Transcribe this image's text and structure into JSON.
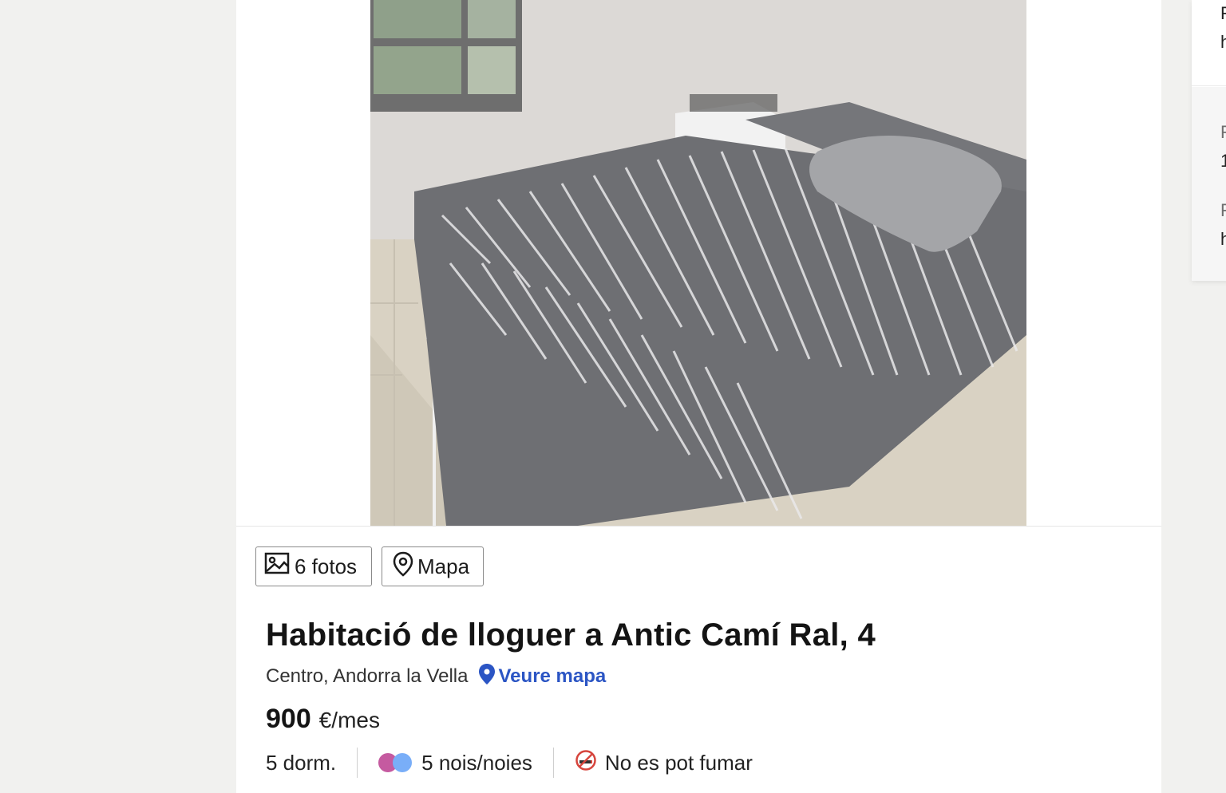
{
  "listing": {
    "photos_button": "6 fotos",
    "map_button": "Mapa",
    "title": "Habitació de lloguer a Antic Camí Ral, 4",
    "location": "Centro, Andorra la Vella",
    "view_map": "Veure mapa",
    "price": "900",
    "price_unit": "€/mes",
    "features": {
      "bedrooms": "5 dorm.",
      "occupants": "5 nois/noies",
      "smoking": "No es pot fumar"
    }
  },
  "sidebar_fragments": [
    "F",
    "h",
    "F",
    "1",
    "F",
    "h"
  ],
  "colors": {
    "link": "#2b55c4",
    "background": "#f1f1ef",
    "occupant_dot_1": "#c55aa0",
    "occupant_dot_2": "#79aef8"
  },
  "icons": {
    "photos": "image-icon",
    "map": "map-pin-outline-icon",
    "view_map": "map-pin-filled-icon",
    "occupants": "people-dots-icon",
    "smoking": "no-smoking-icon"
  }
}
